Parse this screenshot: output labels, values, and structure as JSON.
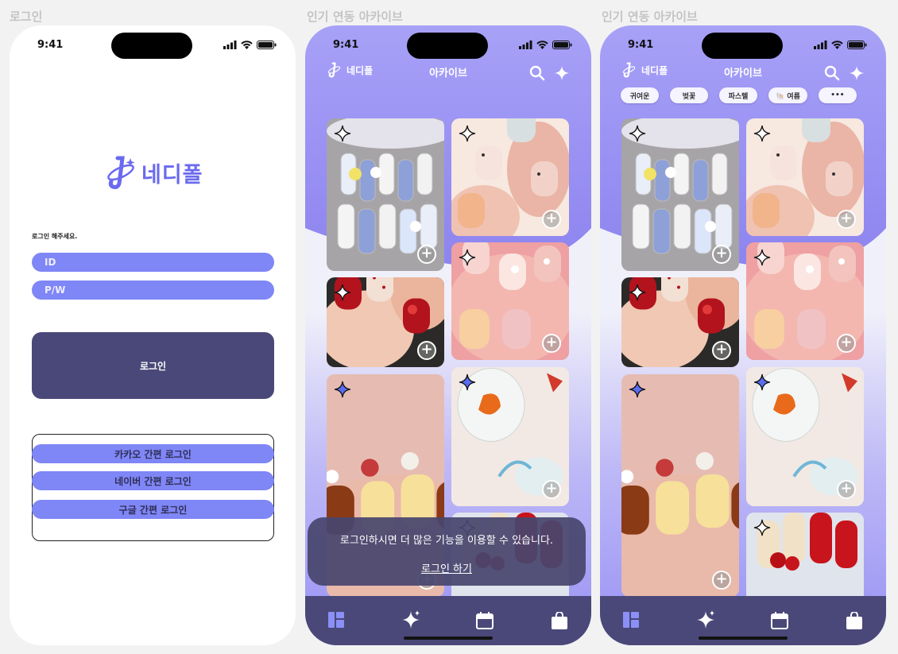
{
  "frames": {
    "login_title": "로그인",
    "archive_title_1": "인기 연동 아카이브",
    "archive_title_2": "인기 연동 아카이브"
  },
  "status": {
    "time": "9:41"
  },
  "brand": {
    "logo_text": "네디폴",
    "accent": "#7f86f6",
    "dark": "#4a4878"
  },
  "login": {
    "prompt": "로그인 해주세요.",
    "id_placeholder": "ID",
    "pw_placeholder": "P/W",
    "login_button": "로그인",
    "social": {
      "kakao": "카카오 간편 로그인",
      "naver": "네이버 간편 로그인",
      "google": "구글 간편 로그인"
    }
  },
  "archive": {
    "title": "아카이브",
    "chips": [
      "귀여운",
      "벚꽃",
      "파스텔",
      "🐚 여름",
      "•••"
    ],
    "toast": {
      "message": "로그인하시면 더 많은 기능을 이용할 수 있습니다.",
      "link": "로그인 하기"
    },
    "cards": [
      {
        "name": "bunny-nails",
        "saved": false
      },
      {
        "name": "pastel-plaid-nails",
        "saved": false
      },
      {
        "name": "strawberry-red-nails",
        "saved": false
      },
      {
        "name": "pink-pearl-nails",
        "saved": false
      },
      {
        "name": "pudding-cherry-nails",
        "saved": true
      },
      {
        "name": "goldfish-nails",
        "saved": true
      },
      {
        "name": "cherry-gold-nails",
        "saved": false
      }
    ],
    "tabs": [
      "dashboard-icon",
      "sparkle-icon",
      "calendar-icon",
      "shopping-bag-icon"
    ]
  }
}
